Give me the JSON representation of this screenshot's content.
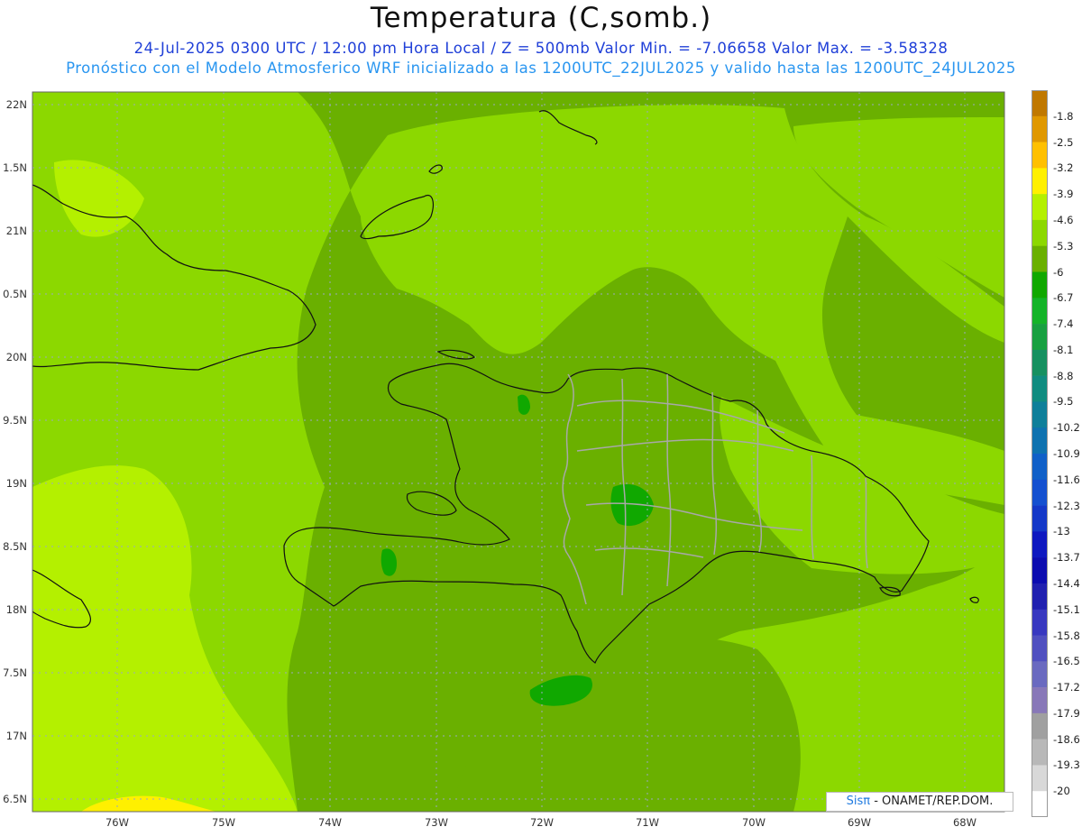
{
  "header": {
    "title": "Temperatura (C,somb.)",
    "subtitle_line1": "24-Jul-2025  0300 UTC / 12:00 pm Hora Local / Z = 500mb  Valor Min. = -7.06658  Valor Max. = -3.58328",
    "subtitle_line2": "Pronóstico con el Modelo Atmosferico WRF inicializado a las 1200UTC_22JUL2025 y valido hasta las  1200UTC_24JUL2025"
  },
  "axes": {
    "lat_labels": [
      "22N",
      "1.5N",
      "21N",
      "0.5N",
      "20N",
      "9.5N",
      "19N",
      "8.5N",
      "18N",
      "7.5N",
      "17N",
      "6.5N"
    ],
    "lon_labels": [
      "76W",
      "75W",
      "74W",
      "73W",
      "72W",
      "71W",
      "70W",
      "69W",
      "68W"
    ]
  },
  "colorbar": {
    "levels": [
      "-1.8",
      "-2.5",
      "-3.2",
      "-3.9",
      "-4.6",
      "-5.3",
      "-6",
      "-6.7",
      "-7.4",
      "-8.1",
      "-8.8",
      "-9.5",
      "-10.2",
      "-10.9",
      "-11.6",
      "-12.3",
      "-13",
      "-13.7",
      "-14.4",
      "-15.1",
      "-15.8",
      "-16.5",
      "-17.2",
      "-17.9",
      "-18.6",
      "-19.3",
      "-20"
    ],
    "colors": [
      "#c07800",
      "#e09800",
      "#ffc000",
      "#fff000",
      "#b4f000",
      "#8cd800",
      "#6ab000",
      "#10a800",
      "#14b428",
      "#18a040",
      "#169060",
      "#108c80",
      "#0e7f9a",
      "#0e72b0",
      "#1060c8",
      "#1450d0",
      "#1438c8",
      "#0e18c0",
      "#0c0cb0",
      "#2020b0",
      "#3838c0",
      "#5050c0",
      "#6a6ac0",
      "#8878b8",
      "#a0a0a0",
      "#b8b8b8",
      "#d8d8d8",
      "#ffffff"
    ]
  },
  "credit": {
    "brand": "Sisπ",
    "text": " - ONAMET/REP.DOM."
  }
}
